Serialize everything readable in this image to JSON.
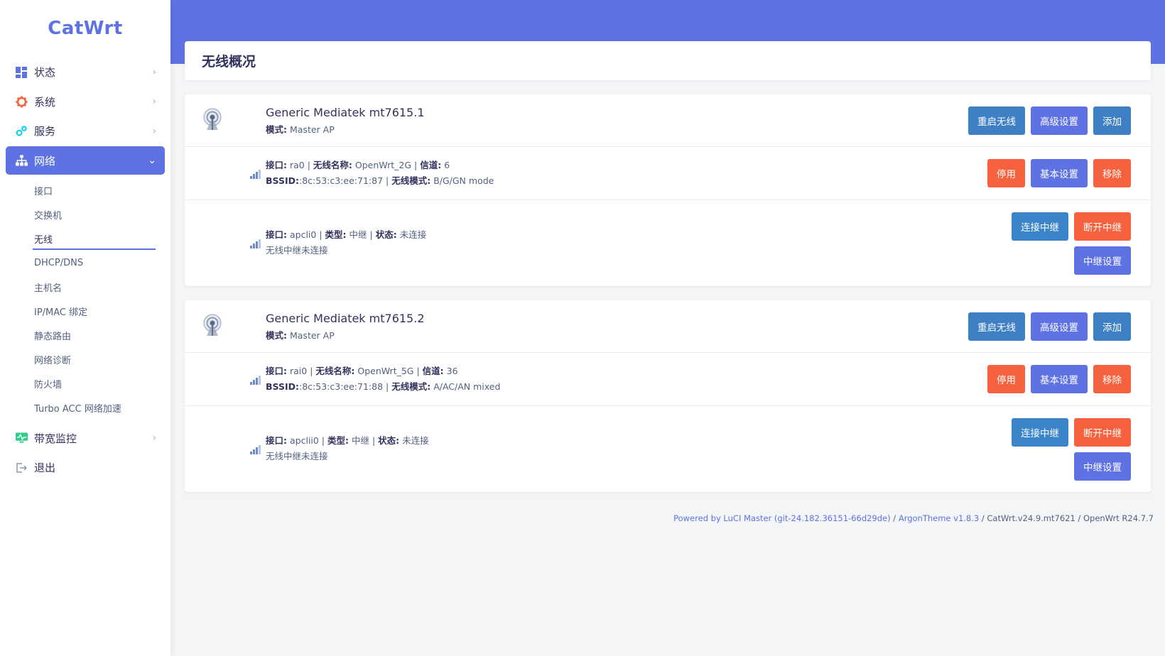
{
  "brand": "CatWrt",
  "colors": {
    "accent": "#5e72e4",
    "danger": "#f5623d",
    "info": "#3f7fc4"
  },
  "sidebar": {
    "items": [
      {
        "label": "状态",
        "icon": "dashboard-icon"
      },
      {
        "label": "系统",
        "icon": "gear-icon"
      },
      {
        "label": "服务",
        "icon": "cogs-icon"
      },
      {
        "label": "网络",
        "icon": "sitemap-icon",
        "active": true
      },
      {
        "label": "带宽监控",
        "icon": "monitor-icon"
      },
      {
        "label": "退出",
        "icon": "logout-icon"
      }
    ],
    "network_sub": [
      "接口",
      "交换机",
      "无线",
      "DHCP/DNS",
      "主机名",
      "IP/MAC 绑定",
      "静态路由",
      "网络诊断",
      "防火墙",
      "Turbo ACC 网络加速"
    ],
    "current_sub": "无线"
  },
  "page": {
    "title": "无线概况"
  },
  "labels": {
    "mode": "模式:",
    "iface": "接口:",
    "ssid": "无线名称:",
    "channel": "信道:",
    "bssid": "BSSID:",
    "hwmode": "无线模式:",
    "type": "类型:",
    "status": "状态:"
  },
  "devices": [
    {
      "name": "Generic Mediatek mt7615.1",
      "mode": "Master AP",
      "head_buttons": [
        "重启无线",
        "高级设置",
        "添加"
      ],
      "net": {
        "iface": "ra0",
        "ssid": "OpenWrt_2G",
        "channel": "6",
        "bssid": ":8c:53:c3:ee:71:87",
        "hwmode": "B/G/GN mode"
      },
      "net_buttons": [
        "停用",
        "基本设置",
        "移除"
      ],
      "rep": {
        "iface": "apcli0",
        "type": "中继",
        "status": "未连接",
        "note": "无线中继未连接"
      },
      "rep_buttons": [
        "连接中继",
        "断开中继",
        "中继设置"
      ]
    },
    {
      "name": "Generic Mediatek mt7615.2",
      "mode": "Master AP",
      "head_buttons": [
        "重启无线",
        "高级设置",
        "添加"
      ],
      "net": {
        "iface": "rai0",
        "ssid": "OpenWrt_5G",
        "channel": "36",
        "bssid": ":8c:53:c3:ee:71:88",
        "hwmode": "A/AC/AN mixed"
      },
      "net_buttons": [
        "停用",
        "基本设置",
        "移除"
      ],
      "rep": {
        "iface": "apclii0",
        "type": "中继",
        "status": "未连接",
        "note": "无线中继未连接"
      },
      "rep_buttons": [
        "连接中继",
        "断开中继",
        "中继设置"
      ]
    }
  ],
  "footer": {
    "luci": "Powered by LuCI Master (git-24.182.36151-66d29de)",
    "sep1": " / ",
    "theme": "ArgonTheme v1.8.3",
    "rest": " / CatWrt.v24.9.mt7621 / OpenWrt R24.7.7"
  }
}
